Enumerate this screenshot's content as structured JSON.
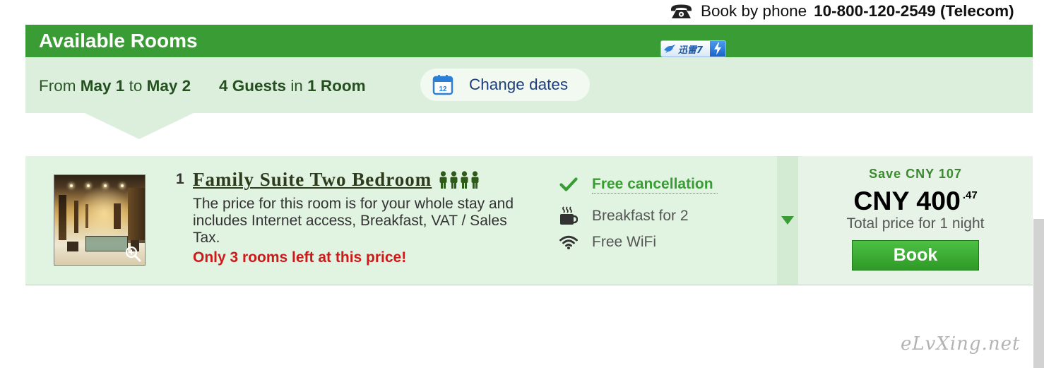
{
  "phone_booking": {
    "label": "Book by phone",
    "number": "10-800-120-2549 (Telecom)",
    "icon": "phone-icon"
  },
  "rooms_section": {
    "title": "Available Rooms"
  },
  "plugin_badge": {
    "label": "迅雷7",
    "icons": [
      "bird-icon",
      "lightning-icon"
    ]
  },
  "stay_summary": {
    "from_label": "From",
    "check_in": "May 1",
    "to_label": "to",
    "check_out": "May 2",
    "guests": "4 Guests",
    "in_label": "in",
    "rooms": "1 Room",
    "change_dates": {
      "label": "Change dates",
      "icon": "calendar-icon",
      "calendar_day": "12"
    }
  },
  "room": {
    "number": "1",
    "name": "Family Suite Two Bedroom",
    "max_occupancy": 4,
    "occupancy_icon": "person-icon",
    "image_icon": "zoom-in-icon",
    "description": "The price for this room is for your whole stay and includes Internet access, Breakfast, VAT / Sales Tax.",
    "availability_alert": "Only 3 rooms left at this price!",
    "features": [
      {
        "icon": "checkmark-icon",
        "label": "Free cancellation"
      },
      {
        "icon": "coffee-cup-icon",
        "label": "Breakfast for 2"
      },
      {
        "icon": "wifi-icon",
        "label": "Free WiFi"
      }
    ],
    "expand_icon": "triangle-down-icon",
    "pricing": {
      "savings": "Save CNY 107",
      "price_main": "CNY 400",
      "price_cents": ".47",
      "price_note": "Total price for 1 night",
      "book_label": "Book"
    }
  },
  "watermark": "eLvXing.net",
  "colors": {
    "brand_green": "#3a9c34",
    "summary_background": "#dcefdc",
    "row_background": "#e1f3e1",
    "alert_red": "#cc1a1a",
    "link_blue": "#1e3d7a",
    "title_text": "#2d3b1c"
  }
}
